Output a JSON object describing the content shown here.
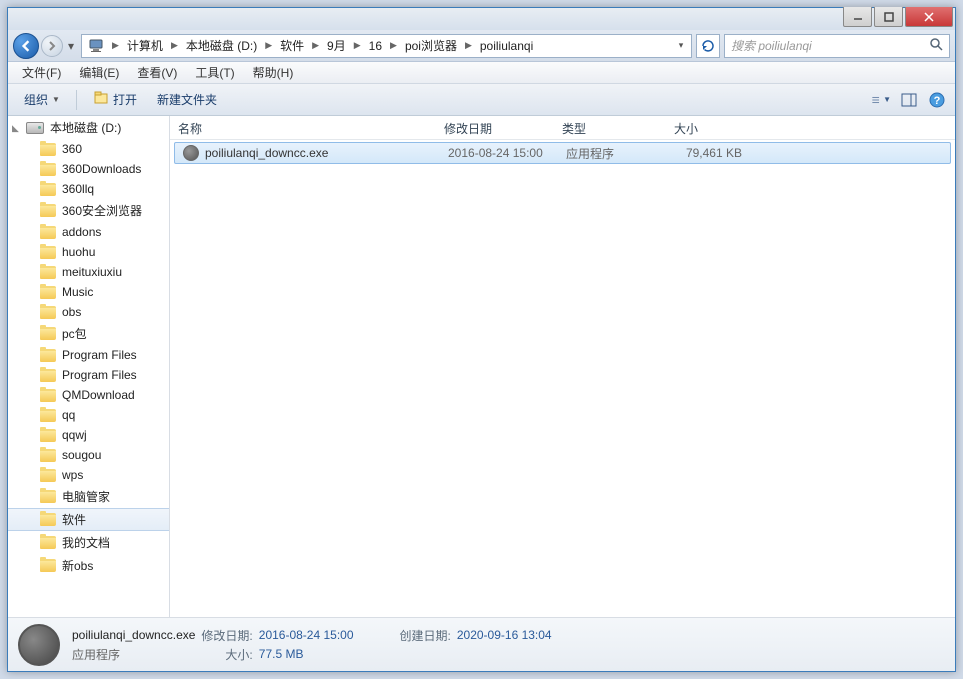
{
  "breadcrumb": {
    "items": [
      "计算机",
      "本地磁盘 (D:)",
      "软件",
      "9月",
      "16",
      "poi浏览器",
      "poiliulanqi"
    ]
  },
  "search": {
    "placeholder": "搜索 poiliulanqi"
  },
  "menubar": {
    "file": "文件(F)",
    "edit": "编辑(E)",
    "view": "查看(V)",
    "tools": "工具(T)",
    "help": "帮助(H)"
  },
  "toolbar": {
    "organize": "组织",
    "open": "打开",
    "newfolder": "新建文件夹"
  },
  "sidebar": {
    "drive": "本地磁盘 (D:)",
    "items": [
      "360",
      "360Downloads",
      "360llq",
      "360安全浏览器",
      "addons",
      "huohu",
      "meituxiuxiu",
      "Music",
      "obs",
      "pc包",
      "Program Files",
      "Program Files",
      "QMDownload",
      "qq",
      "qqwj",
      "sougou",
      "wps",
      "电脑管家",
      "软件",
      "我的文档",
      "新obs"
    ],
    "selected_index": 18
  },
  "columns": {
    "name": "名称",
    "date": "修改日期",
    "type": "类型",
    "size": "大小"
  },
  "files": [
    {
      "name": "poiliulanqi_downcc.exe",
      "date": "2016-08-24 15:00",
      "type": "应用程序",
      "size": "79,461 KB",
      "selected": true
    }
  ],
  "details": {
    "filename": "poiliulanqi_downcc.exe",
    "filetype": "应用程序",
    "mod_label": "修改日期:",
    "mod_value": "2016-08-24 15:00",
    "size_label": "大小:",
    "size_value": "77.5 MB",
    "created_label": "创建日期:",
    "created_value": "2020-09-16 13:04"
  }
}
